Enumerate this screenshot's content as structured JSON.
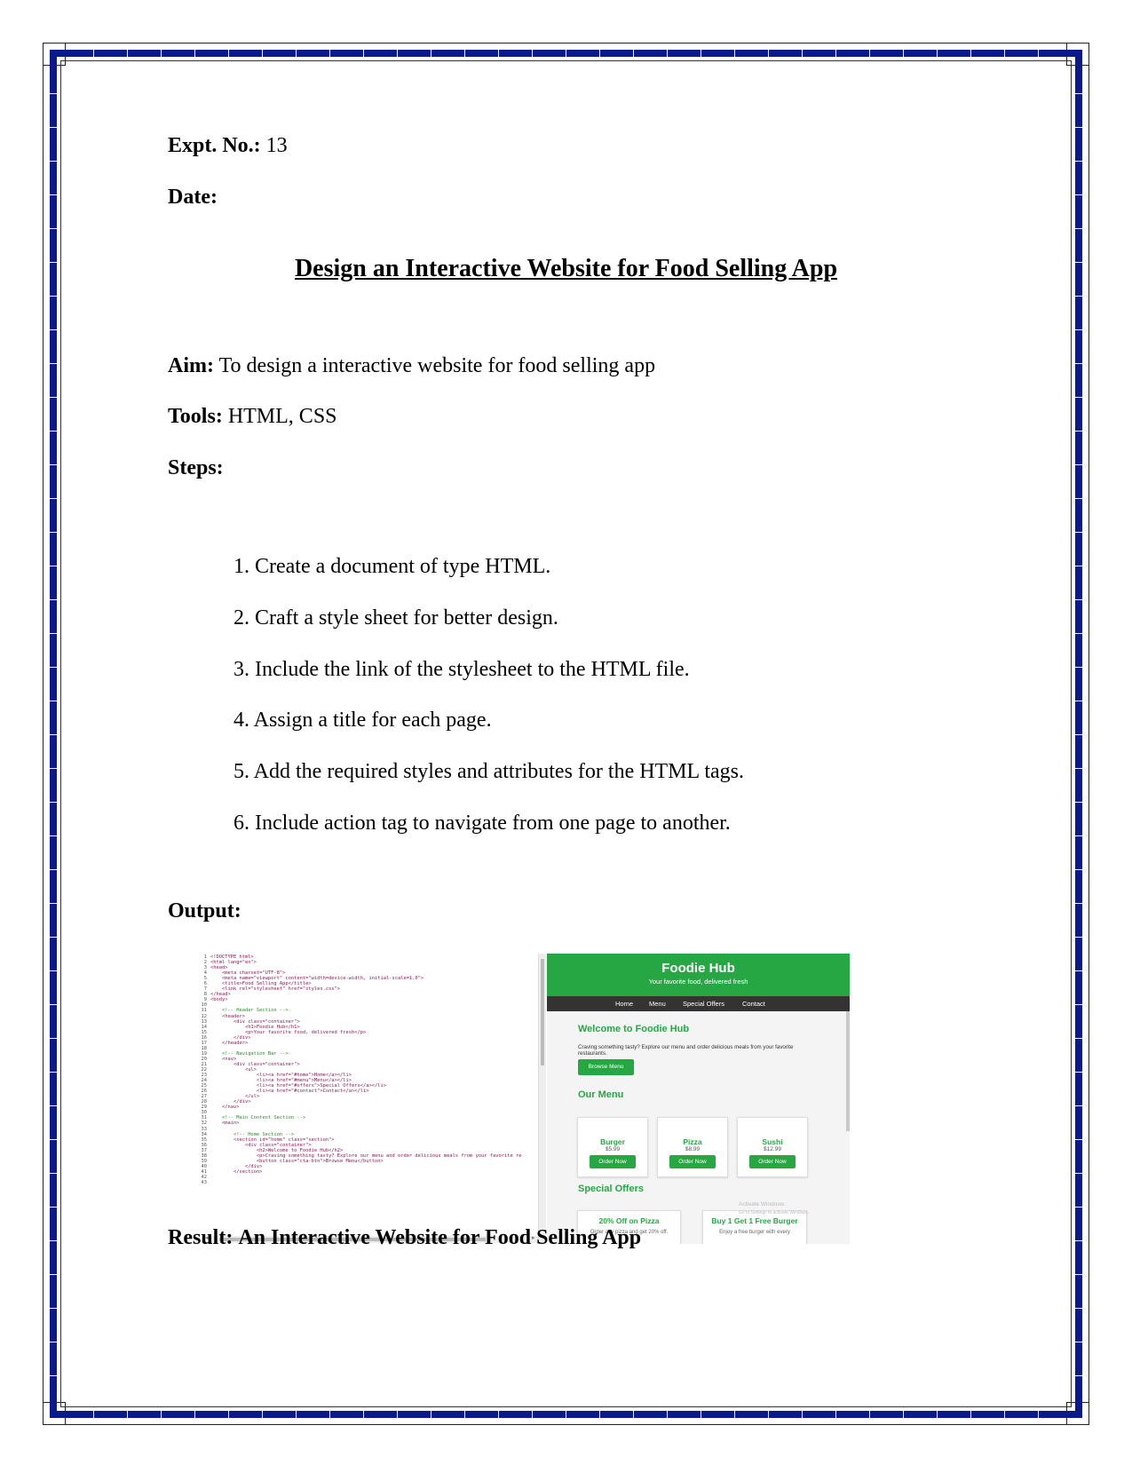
{
  "expt": {
    "label": "Expt. No.:",
    "value": "13"
  },
  "date": {
    "label": "Date:"
  },
  "title": "Design an Interactive Website for Food Selling App",
  "aim": {
    "label": "Aim:",
    "text": "To design a interactive website for food selling app"
  },
  "tools": {
    "label": "Tools:",
    "text": "HTML, CSS"
  },
  "steps": {
    "label": "Steps:",
    "items": [
      "1. Create a document of type HTML.",
      "2. Craft a style sheet for better design.",
      "3. Include the link of the stylesheet to the HTML file.",
      "4. Assign a title for each page.",
      "5. Add the required styles and attributes for the HTML tags.",
      "6. Include action tag to navigate from one page to another."
    ]
  },
  "output": {
    "label": "Output:"
  },
  "result": {
    "label": "Result:",
    "text": "An Interactive Website for Food Selling App"
  },
  "screenshot": {
    "editor": {
      "line_numbers": [
        "1",
        "2",
        "3",
        "4",
        "5",
        "6",
        "7",
        "8",
        "9",
        "10",
        "11",
        "12",
        "13",
        "14",
        "15",
        "16",
        "17",
        "18",
        "19",
        "20",
        "21",
        "22",
        "23",
        "24",
        "25",
        "26",
        "27",
        "28",
        "29",
        "30",
        "31",
        "32",
        "33",
        "34",
        "35",
        "36",
        "37",
        "38",
        "39",
        "40",
        "41",
        "42",
        "43"
      ],
      "code_lines": [
        "<!DOCTYPE html>",
        "<html lang=\"en\">",
        "<head>",
        "    <meta charset=\"UTF-8\">",
        "    <meta name=\"viewport\" content=\"width=device-width, initial-scale=1.0\">",
        "    <title>Food Selling App</title>",
        "    <link rel=\"stylesheet\" href=\"styles.css\">",
        "</head>",
        "<body>",
        "",
        "    <!-- Header Section -->",
        "    <header>",
        "        <div class=\"container\">",
        "            <h1>Foodie Hub</h1>",
        "            <p>Your favorite food, delivered fresh</p>",
        "        </div>",
        "    </header>",
        "",
        "    <!-- Navigation Bar -->",
        "    <nav>",
        "        <div class=\"container\">",
        "            <ul>",
        "                <li><a href=\"#home\">Home</a></li>",
        "                <li><a href=\"#menu\">Menu</a></li>",
        "                <li><a href=\"#offers\">Special Offers</a></li>",
        "                <li><a href=\"#contact\">Contact</a></li>",
        "            </ul>",
        "        </div>",
        "    </nav>",
        "",
        "    <!-- Main Content Section -->",
        "    <main>",
        "",
        "        <!-- Home Section -->",
        "        <section id=\"home\" class=\"section\">",
        "            <div class=\"container\">",
        "                <h2>Welcome to Foodie Hub</h2>",
        "                <p>Craving something tasty? Explore our menu and order delicious meals from your favorite re",
        "                <button class=\"cta-btn\">Browse Menu</button>",
        "            </div>",
        "        </section>",
        "",
        ""
      ]
    },
    "site": {
      "title": "Foodie Hub",
      "tagline": "Your favorite food, delivered fresh",
      "nav": [
        "Home",
        "Menu",
        "Special Offers",
        "Contact"
      ],
      "welcome_heading": "Welcome to Foodie Hub",
      "welcome_text": "Craving something tasty? Explore our menu and order delicious meals from your favorite restaurants.",
      "browse_button": "Browse Menu",
      "menu_heading": "Our Menu",
      "menu_items": [
        {
          "name": "Burger",
          "price": "$5.99",
          "button": "Order Now"
        },
        {
          "name": "Pizza",
          "price": "$8.99",
          "button": "Order Now"
        },
        {
          "name": "Sushi",
          "price": "$12.99",
          "button": "Order Now"
        }
      ],
      "offers_heading": "Special Offers",
      "offers": [
        {
          "title": "20% Off on Pizza",
          "text": "Order any pizza and get 20% off."
        },
        {
          "title": "Buy 1 Get 1 Free Burger",
          "text": "Enjoy a free burger with every"
        }
      ],
      "watermark": {
        "line1": "Activate Windows",
        "line2": "Go to Settings to activate Windows."
      }
    }
  },
  "colors": {
    "border": "#0a1a8c",
    "site_green": "#27a744",
    "nav_dark": "#333333"
  }
}
